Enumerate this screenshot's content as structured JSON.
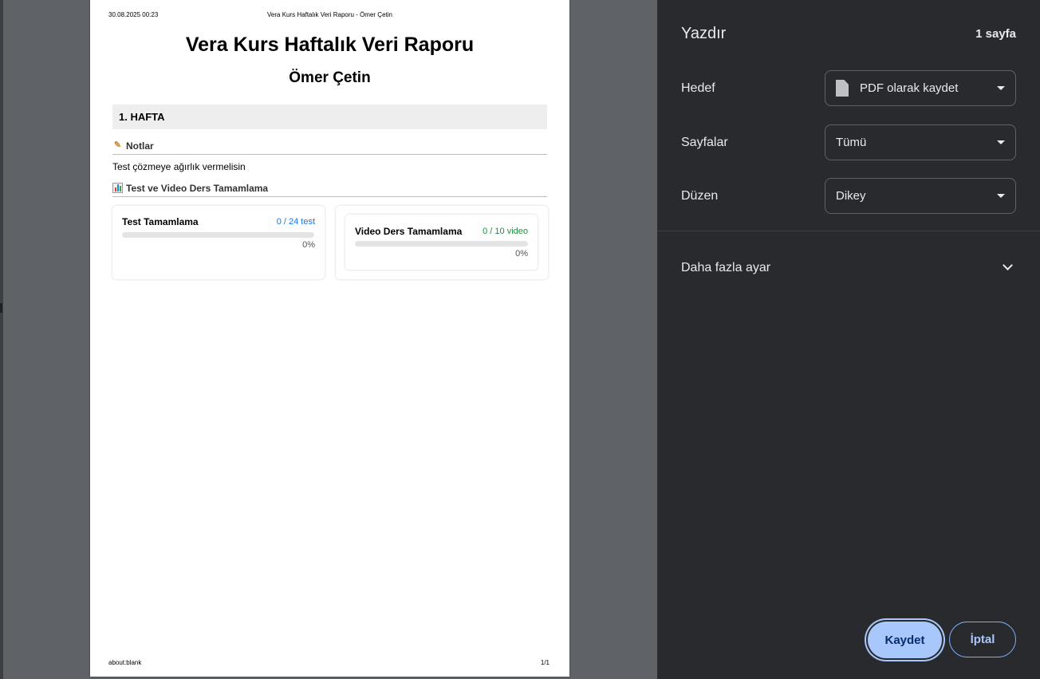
{
  "preview": {
    "header_date": "30.08.2025 00:23",
    "header_title": "Vera Kurs Haftalık Veri Raporu - Ömer Çetin",
    "footer_left": "about:blank",
    "footer_right": "1/1",
    "title": "Vera Kurs Haftalık Veri Raporu",
    "student_name": "Ömer Çetin",
    "week_label": "1. HAFTA",
    "notes_heading": "Notlar",
    "notes_icon": "memo-icon",
    "note_text": "Test çözmeye ağırlık vermelisin",
    "progress_heading": "Test ve Video Ders Tamamlama",
    "progress_icon": "bar-chart-icon",
    "cards": [
      {
        "title": "Test Tamamlama",
        "count": "0 / 24 test",
        "percent": "0%",
        "progress": 0,
        "accent": "#1a73e8"
      },
      {
        "title": "Video Ders Tamamlama",
        "count": "0 / 10 video",
        "percent": "0%",
        "progress": 0,
        "accent": "#1e8e3e"
      }
    ]
  },
  "print_panel": {
    "title": "Yazdır",
    "page_count": "1 sayfa",
    "destination_label": "Hedef",
    "destination_value": "PDF olarak kaydet",
    "destination_icon": "document-icon",
    "pages_label": "Sayfalar",
    "pages_value": "Tümü",
    "layout_label": "Düzen",
    "layout_value": "Dikey",
    "more_settings": "Daha fazla ayar",
    "save_button": "Kaydet",
    "cancel_button": "İptal"
  }
}
